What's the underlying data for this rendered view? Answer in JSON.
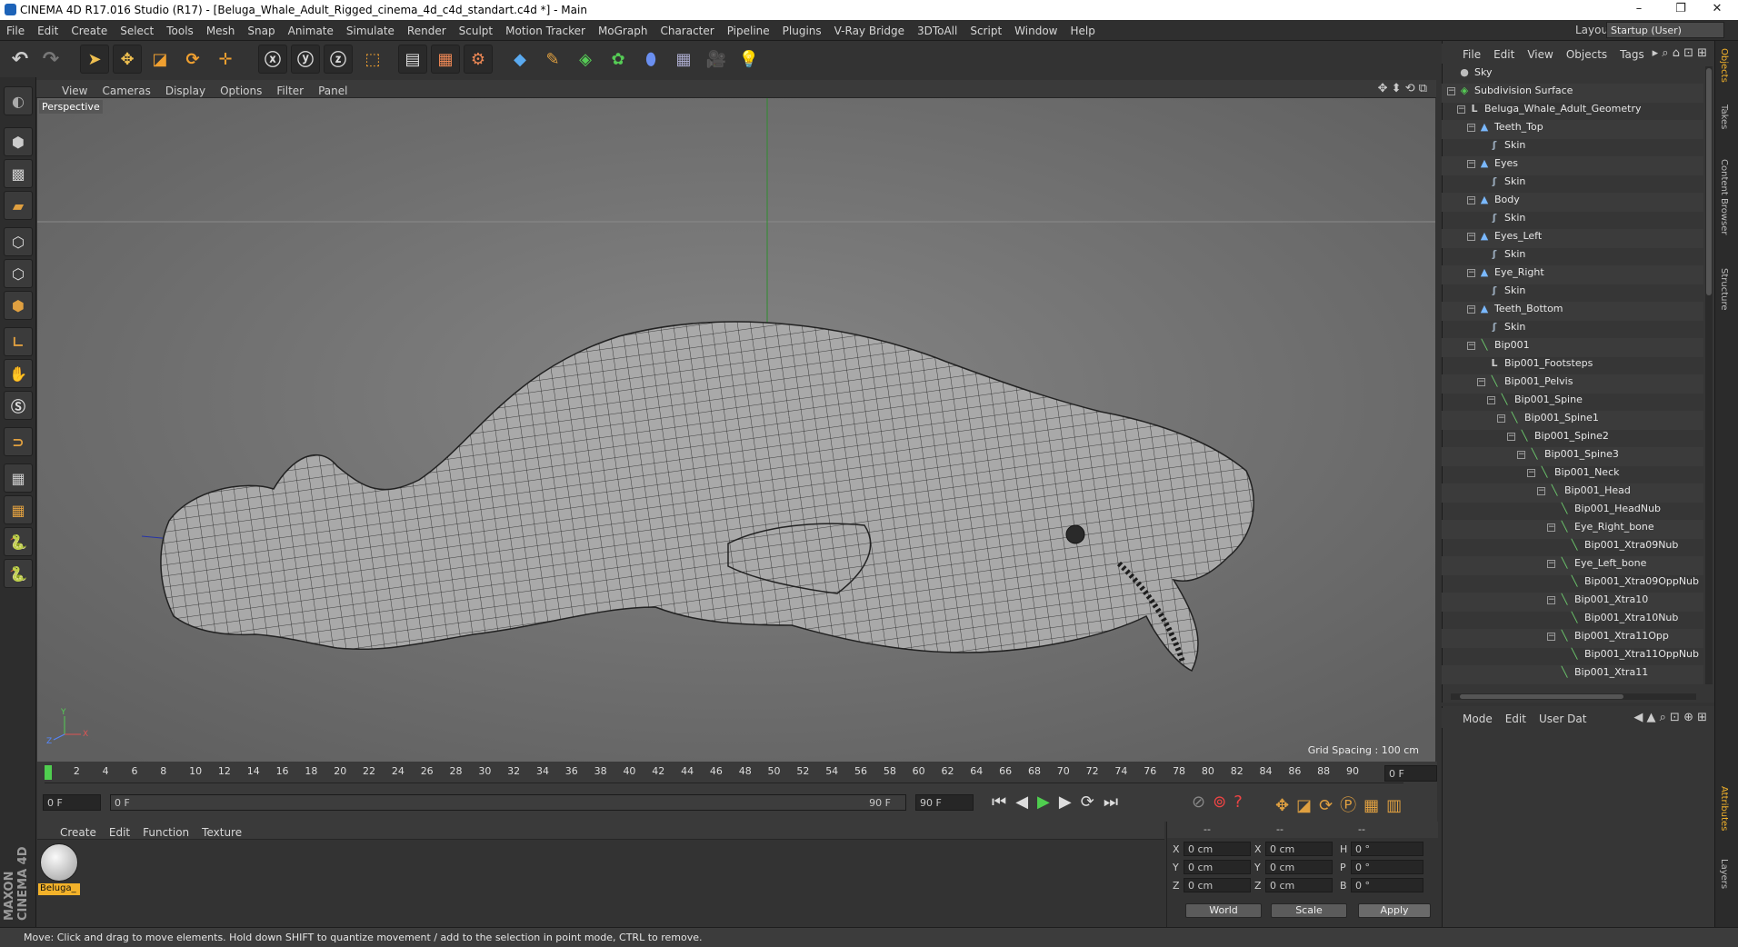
{
  "titlebar": {
    "title": "CINEMA 4D R17.016 Studio (R17) - [Beluga_Whale_Adult_Rigged_cinema_4d_c4d_standart.c4d *] - Main",
    "min": "–",
    "max": "❐",
    "close": "✕"
  },
  "menubar": [
    "File",
    "Edit",
    "Create",
    "Select",
    "Tools",
    "Mesh",
    "Snap",
    "Animate",
    "Simulate",
    "Render",
    "Sculpt",
    "Motion Tracker",
    "MoGraph",
    "Character",
    "Pipeline",
    "Plugins",
    "V-Ray Bridge",
    "3DToAll",
    "Script",
    "Window",
    "Help"
  ],
  "layout": {
    "label": "Layout:",
    "value": "Startup (User)"
  },
  "viewport": {
    "menu": [
      "View",
      "Cameras",
      "Display",
      "Options",
      "Filter",
      "Panel"
    ],
    "label": "Perspective",
    "grid_spacing": "Grid Spacing : 100 cm"
  },
  "timeline": {
    "ticks": [
      "0",
      "2",
      "4",
      "6",
      "8",
      "10",
      "12",
      "14",
      "16",
      "18",
      "20",
      "22",
      "24",
      "26",
      "28",
      "30",
      "32",
      "34",
      "36",
      "38",
      "40",
      "42",
      "44",
      "46",
      "48",
      "50",
      "52",
      "54",
      "56",
      "58",
      "60",
      "62",
      "64",
      "66",
      "68",
      "70",
      "72",
      "74",
      "76",
      "78",
      "80",
      "82",
      "84",
      "86",
      "88",
      "90"
    ],
    "current_frame": "0 F",
    "start": "0 F",
    "range_start": "0 F",
    "range_end": "90 F",
    "end": "90 F"
  },
  "material_panel": {
    "menu": [
      "Create",
      "Edit",
      "Function",
      "Texture"
    ],
    "material_name": "Beluga_"
  },
  "coordinates": {
    "headers": [
      "--",
      "--",
      "--"
    ],
    "rows": [
      {
        "axis": "X",
        "pos": "0 cm",
        "axis2": "X",
        "size": "0 cm",
        "rot_axis": "H",
        "rot": "0 °"
      },
      {
        "axis": "Y",
        "pos": "0 cm",
        "axis2": "Y",
        "size": "0 cm",
        "rot_axis": "P",
        "rot": "0 °"
      },
      {
        "axis": "Z",
        "pos": "0 cm",
        "axis2": "Z",
        "size": "0 cm",
        "rot_axis": "B",
        "rot": "0 °"
      }
    ],
    "mode1": "World",
    "mode2": "Scale",
    "apply": "Apply"
  },
  "object_manager": {
    "menu": [
      "File",
      "Edit",
      "View",
      "Objects",
      "Tags"
    ],
    "items": [
      {
        "name": "Sky",
        "depth": 0,
        "icon": "sky"
      },
      {
        "name": "Subdivision Surface",
        "depth": 0,
        "icon": "subdiv"
      },
      {
        "name": "Beluga_Whale_Adult_Geometry",
        "depth": 1,
        "icon": "null"
      },
      {
        "name": "Teeth_Top",
        "depth": 2,
        "icon": "mesh"
      },
      {
        "name": "Skin",
        "depth": 3,
        "icon": "skin"
      },
      {
        "name": "Eyes",
        "depth": 2,
        "icon": "mesh"
      },
      {
        "name": "Skin",
        "depth": 3,
        "icon": "skin"
      },
      {
        "name": "Body",
        "depth": 2,
        "icon": "mesh"
      },
      {
        "name": "Skin",
        "depth": 3,
        "icon": "skin"
      },
      {
        "name": "Eyes_Left",
        "depth": 2,
        "icon": "mesh"
      },
      {
        "name": "Skin",
        "depth": 3,
        "icon": "skin"
      },
      {
        "name": "Eye_Right",
        "depth": 2,
        "icon": "mesh"
      },
      {
        "name": "Skin",
        "depth": 3,
        "icon": "skin"
      },
      {
        "name": "Teeth_Bottom",
        "depth": 2,
        "icon": "mesh"
      },
      {
        "name": "Skin",
        "depth": 3,
        "icon": "skin"
      },
      {
        "name": "Bip001",
        "depth": 2,
        "icon": "joint"
      },
      {
        "name": "Bip001_Footsteps",
        "depth": 3,
        "icon": "null"
      },
      {
        "name": "Bip001_Pelvis",
        "depth": 3,
        "icon": "joint"
      },
      {
        "name": "Bip001_Spine",
        "depth": 4,
        "icon": "joint"
      },
      {
        "name": "Bip001_Spine1",
        "depth": 5,
        "icon": "joint"
      },
      {
        "name": "Bip001_Spine2",
        "depth": 6,
        "icon": "joint"
      },
      {
        "name": "Bip001_Spine3",
        "depth": 7,
        "icon": "joint"
      },
      {
        "name": "Bip001_Neck",
        "depth": 8,
        "icon": "joint"
      },
      {
        "name": "Bip001_Head",
        "depth": 9,
        "icon": "joint"
      },
      {
        "name": "Bip001_HeadNub",
        "depth": 10,
        "icon": "joint"
      },
      {
        "name": "Eye_Right_bone",
        "depth": 10,
        "icon": "joint"
      },
      {
        "name": "Bip001_Xtra09Nub",
        "depth": 11,
        "icon": "joint"
      },
      {
        "name": "Eye_Left_bone",
        "depth": 10,
        "icon": "joint"
      },
      {
        "name": "Bip001_Xtra09OppNub",
        "depth": 11,
        "icon": "joint"
      },
      {
        "name": "Bip001_Xtra10",
        "depth": 10,
        "icon": "joint"
      },
      {
        "name": "Bip001_Xtra10Nub",
        "depth": 11,
        "icon": "joint"
      },
      {
        "name": "Bip001_Xtra11Opp",
        "depth": 10,
        "icon": "joint"
      },
      {
        "name": "Bip001_Xtra11OppNub",
        "depth": 11,
        "icon": "joint"
      },
      {
        "name": "Bip001_Xtra11",
        "depth": 10,
        "icon": "joint"
      }
    ]
  },
  "attribute_manager": {
    "menu": [
      "Mode",
      "Edit",
      "User Dat"
    ]
  },
  "right_tabs": [
    "Objects",
    "Takes",
    "Content Browser",
    "Structure",
    "Attributes",
    "Layers"
  ],
  "statusbar": "Move: Click and drag to move elements. Hold down SHIFT to quantize movement / add to the selection in point mode, CTRL to remove.",
  "branding": "MAXON CINEMA 4D",
  "colors": {
    "accent": "#e0a040",
    "selection": "#f3b22a",
    "joint": "#6fd16f",
    "mesh": "#7ab8ff",
    "bg": "#333333"
  }
}
